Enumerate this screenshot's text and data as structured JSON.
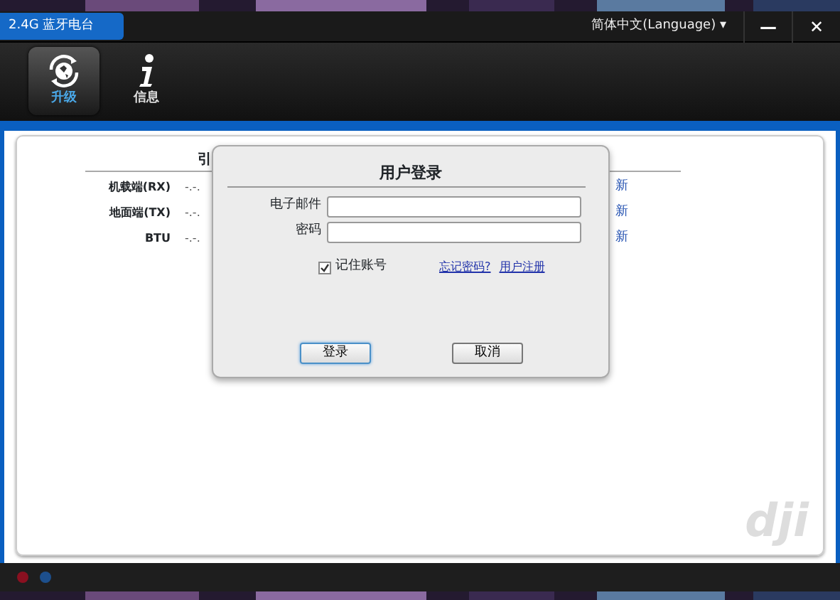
{
  "window": {
    "title": "2.4G  蓝牙电台",
    "language": "简体中文(Language)",
    "caret": "▾",
    "minimize": "—",
    "close": "✕"
  },
  "tabs": [
    {
      "label": "升级",
      "selected": true
    },
    {
      "label": "信息",
      "selected": false
    }
  ],
  "table": {
    "heading": "引",
    "rows": [
      {
        "label": "机载端(RX)",
        "value": "-.-.",
        "action": "新"
      },
      {
        "label": "地面端(TX)",
        "value": "-.-.",
        "action": "新"
      },
      {
        "label": "BTU",
        "value": "-.-.",
        "action": "新"
      }
    ]
  },
  "logo": "dji",
  "status_lights": [
    {
      "color": "#8a1020"
    },
    {
      "color": "#1d4f8c"
    }
  ],
  "dialog": {
    "title": "用户登录",
    "fields": [
      {
        "label": "电子邮件"
      },
      {
        "label": "密码"
      }
    ],
    "remember": {
      "label": "记住账号",
      "checked": true
    },
    "links": [
      "忘记密码?",
      "用户注册"
    ],
    "buttons": [
      "登录",
      "取消"
    ]
  }
}
